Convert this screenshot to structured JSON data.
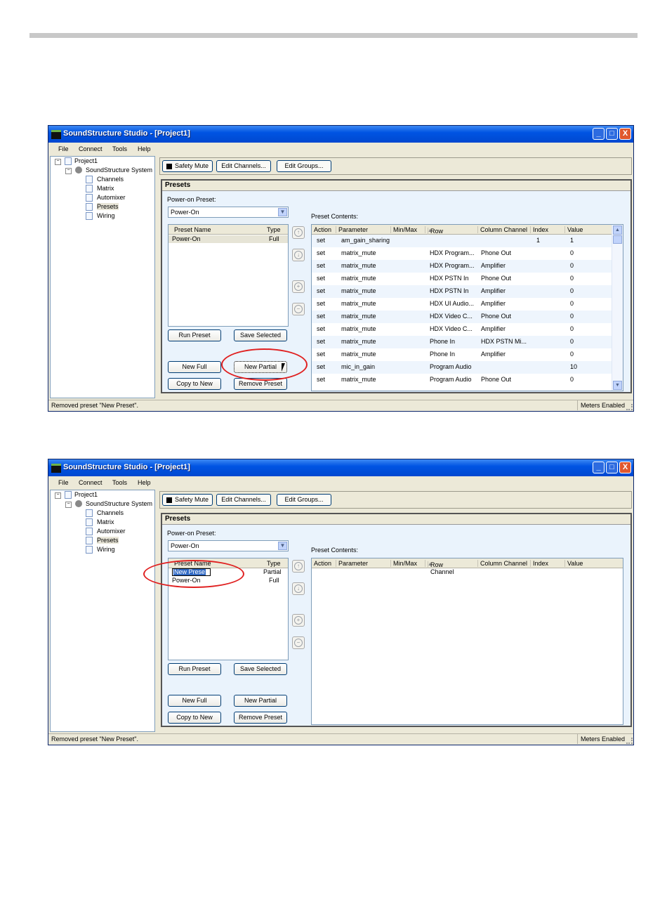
{
  "window": {
    "title": "SoundStructure Studio - [Project1]",
    "minimize_glyph": "_",
    "maximize_glyph": "□",
    "close_glyph": "X"
  },
  "menu": [
    "File",
    "Connect",
    "Tools",
    "Help"
  ],
  "tree": {
    "project": "Project1",
    "system": "SoundStructure System",
    "children": [
      "Channels",
      "Matrix",
      "Automixer",
      "Presets",
      "Wiring"
    ],
    "selected": "Presets",
    "expander_glyph": "−"
  },
  "toolbar": {
    "safety_mute": "Safety Mute",
    "edit_channels": "Edit Channels...",
    "edit_groups": "Edit Groups..."
  },
  "presets": {
    "heading": "Presets",
    "power_on_label": "Power-on Preset:",
    "power_on_value": "Power-On",
    "contents_label": "Preset Contents:",
    "list_headers": {
      "name": "Preset Name",
      "type": "Type"
    },
    "buttons": {
      "run": "Run Preset",
      "save_selected": "Save Selected",
      "new_full": "New Full",
      "new_partial": "New Partial",
      "copy_to_new": "Copy to New",
      "remove": "Remove Preset"
    },
    "side_buttons": {
      "up": "↑",
      "down": "↓",
      "add": "+",
      "remove": "−"
    },
    "dropdown_glyph": "▼",
    "table_headers": {
      "action": "Action",
      "parameter": "Parameter",
      "minmax": "Min/Max",
      "row_channel": "Row Channel",
      "sort_glyph": "▲",
      "column_channel": "Column Channel",
      "index": "Index",
      "value": "Value"
    },
    "scroll_glyphs": {
      "up": "▲",
      "down": "▼"
    }
  },
  "screen1": {
    "preset_list": [
      {
        "name": "Power-On",
        "type": "Full"
      }
    ],
    "contents": [
      {
        "action": "set",
        "parameter": "am_gain_sharing",
        "minmax": "",
        "row": "",
        "col": "",
        "index": "1",
        "value": "1"
      },
      {
        "action": "set",
        "parameter": "matrix_mute",
        "minmax": "",
        "row": "HDX Program...",
        "col": "Phone Out",
        "index": "",
        "value": "0"
      },
      {
        "action": "set",
        "parameter": "matrix_mute",
        "minmax": "",
        "row": "HDX Program...",
        "col": "Amplifier",
        "index": "",
        "value": "0"
      },
      {
        "action": "set",
        "parameter": "matrix_mute",
        "minmax": "",
        "row": "HDX PSTN In",
        "col": "Phone Out",
        "index": "",
        "value": "0"
      },
      {
        "action": "set",
        "parameter": "matrix_mute",
        "minmax": "",
        "row": "HDX PSTN In",
        "col": "Amplifier",
        "index": "",
        "value": "0"
      },
      {
        "action": "set",
        "parameter": "matrix_mute",
        "minmax": "",
        "row": "HDX UI Audio...",
        "col": "Amplifier",
        "index": "",
        "value": "0"
      },
      {
        "action": "set",
        "parameter": "matrix_mute",
        "minmax": "",
        "row": "HDX Video C...",
        "col": "Phone Out",
        "index": "",
        "value": "0"
      },
      {
        "action": "set",
        "parameter": "matrix_mute",
        "minmax": "",
        "row": "HDX Video C...",
        "col": "Amplifier",
        "index": "",
        "value": "0"
      },
      {
        "action": "set",
        "parameter": "matrix_mute",
        "minmax": "",
        "row": "Phone In",
        "col": "HDX PSTN Mi...",
        "index": "",
        "value": "0"
      },
      {
        "action": "set",
        "parameter": "matrix_mute",
        "minmax": "",
        "row": "Phone In",
        "col": "Amplifier",
        "index": "",
        "value": "0"
      },
      {
        "action": "set",
        "parameter": "mic_in_gain",
        "minmax": "",
        "row": "Program Audio",
        "col": "",
        "index": "",
        "value": "10"
      },
      {
        "action": "set",
        "parameter": "matrix_mute",
        "minmax": "",
        "row": "Program Audio",
        "col": "Phone Out",
        "index": "",
        "value": "0"
      }
    ]
  },
  "screen2": {
    "editing_name": "New Prese",
    "editing_type": "Partial",
    "preset_list": [
      {
        "name": "Power-On",
        "type": "Full"
      }
    ]
  },
  "status": {
    "message": "Removed preset \"New Preset\".",
    "meters": "Meters Enabled"
  },
  "colors": {
    "title_bar": "#0054e3",
    "annotation": "#e02020",
    "selection": "#316ac5"
  }
}
